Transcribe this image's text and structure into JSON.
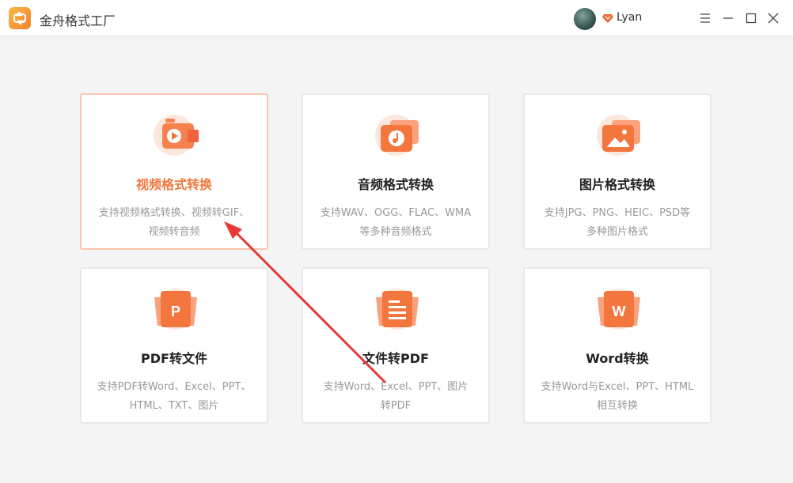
{
  "app": {
    "title": "金舟格式工厂"
  },
  "user": {
    "name": "Lyan"
  },
  "icons": {
    "logo": "app-logo-icon",
    "vip": "vip-diamond-icon",
    "menu": "menu-icon",
    "minimize": "minimize-icon",
    "maximize": "maximize-icon",
    "close": "close-icon"
  },
  "colors": {
    "accent": "#f2763d",
    "active_border": "#f9c6ad",
    "arrow": "#e53935"
  },
  "cards": [
    {
      "title": "视频格式转换",
      "desc1": "支持视频格式转换、视频转GIF、",
      "desc2": "视频转音频",
      "icon": "video-icon",
      "active": true
    },
    {
      "title": "音频格式转换",
      "desc1": "支持WAV、OGG、FLAC、WMA",
      "desc2": "等多种音频格式",
      "icon": "audio-icon"
    },
    {
      "title": "图片格式转换",
      "desc1": "支持JPG、PNG、HEIC、PSD等",
      "desc2": "多种图片格式",
      "icon": "image-icon"
    },
    {
      "title": "PDF转文件",
      "desc1": "支持PDF转Word、Excel、PPT、",
      "desc2": "HTML、TXT、图片",
      "icon": "pdf-icon",
      "glyph": "P"
    },
    {
      "title": "文件转PDF",
      "desc1": "支持Word、Excel、PPT、图片",
      "desc2": "转PDF",
      "icon": "document-icon"
    },
    {
      "title": "Word转换",
      "desc1": "支持Word与Excel、PPT、HTML",
      "desc2": "相互转换",
      "icon": "word-icon",
      "glyph": "W"
    }
  ]
}
